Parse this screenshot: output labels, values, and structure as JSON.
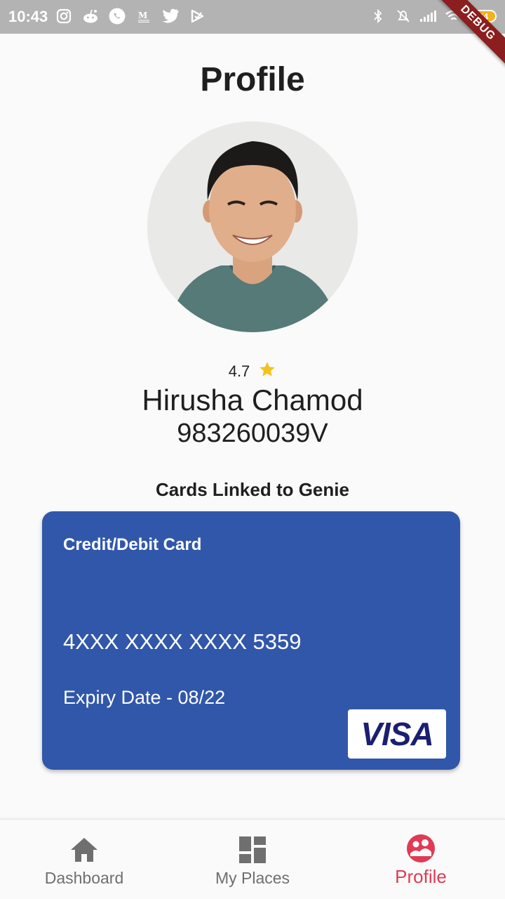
{
  "status_bar": {
    "time": "10:43",
    "battery": "84",
    "debug_label": "DEBUG"
  },
  "page": {
    "title": "Profile"
  },
  "profile": {
    "rating": "4.7",
    "name": "Hirusha Chamod",
    "nic": "983260039V"
  },
  "cards_section": {
    "title": "Cards Linked to Genie",
    "card": {
      "type": "Credit/Debit Card",
      "number": "4XXX XXXX XXXX 5359",
      "expiry": "Expiry Date - 08/22",
      "brand": "VISA",
      "color": "#3157aa"
    }
  },
  "bottom_nav": {
    "items": [
      {
        "label": "Dashboard",
        "icon": "home-icon",
        "active": false
      },
      {
        "label": "My Places",
        "icon": "dashboard-grid-icon",
        "active": false
      },
      {
        "label": "Profile",
        "icon": "people-circle-icon",
        "active": true
      }
    ],
    "active_color": "#e03a55",
    "inactive_color": "#6f6f6f"
  },
  "colors": {
    "star": "#f5c21b",
    "status_bar": "#b3b3b3"
  }
}
